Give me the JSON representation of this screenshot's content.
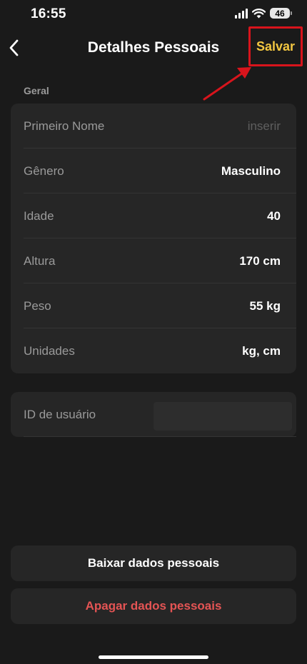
{
  "status_bar": {
    "time": "16:55",
    "battery": "46"
  },
  "nav": {
    "title": "Detalhes Pessoais",
    "save_label": "Salvar",
    "highlight_color": "#d8141c",
    "save_color": "#f2c641"
  },
  "general": {
    "section_label": "Geral",
    "rows": [
      {
        "label": "Primeiro Nome",
        "value": "",
        "placeholder": "inserir"
      },
      {
        "label": "Gênero",
        "value": "Masculino"
      },
      {
        "label": "Idade",
        "value": "40"
      },
      {
        "label": "Altura",
        "value": "170 cm"
      },
      {
        "label": "Peso",
        "value": "55 kg"
      },
      {
        "label": "Unidades",
        "value": "kg, cm"
      }
    ]
  },
  "user_id": {
    "label": "ID de usuário",
    "value": ""
  },
  "actions": {
    "download_label": "Baixar dados pessoais",
    "delete_label": "Apagar dados pessoais",
    "delete_color": "#e45454"
  }
}
